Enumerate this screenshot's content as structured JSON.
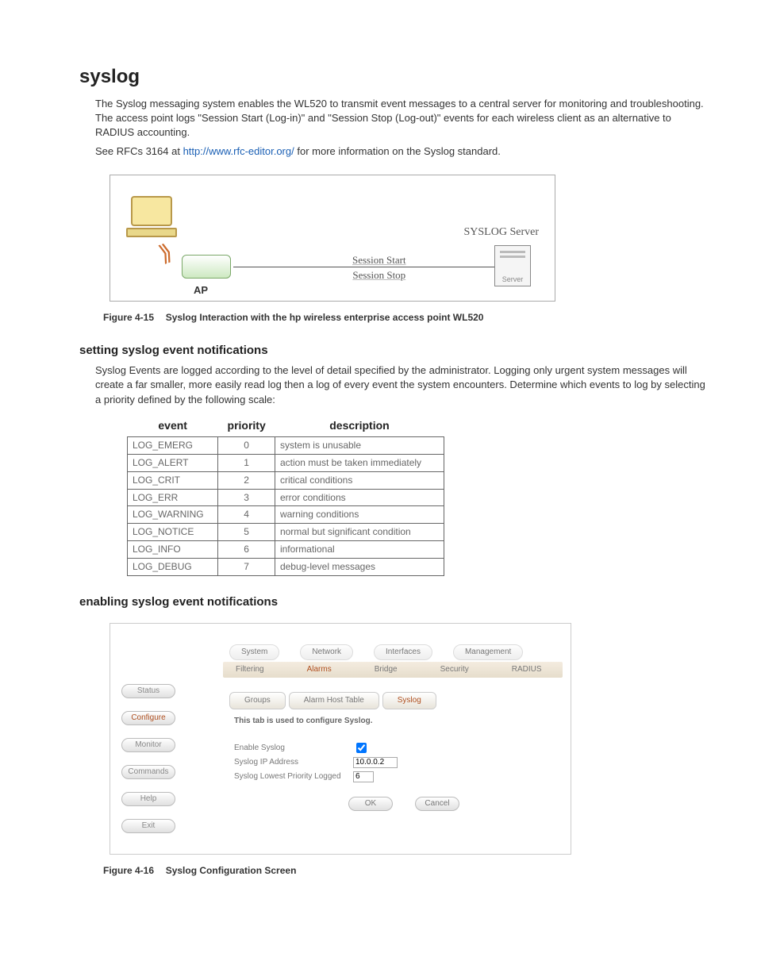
{
  "h1": "syslog",
  "intro_p1": "The Syslog messaging system enables the WL520 to transmit event messages to a central server for monitoring and troubleshooting. The access point logs \"Session Start (Log-in)\" and \"Session Stop (Log-out)\" events for each wireless client as an alternative to RADIUS accounting.",
  "intro_p2_a": "See RFCs 3164 at ",
  "intro_link": "http://www.rfc-editor.org/",
  "intro_p2_b": " for more information on the Syslog standard.",
  "diagram": {
    "ap_label": "AP",
    "session_start": "Session Start",
    "session_stop": "Session Stop",
    "server_title": "SYSLOG Server",
    "server_box": "Server"
  },
  "fig15_num": "Figure 4-15",
  "fig15_text": "Syslog Interaction with the hp wireless enterprise access point WL520",
  "h2_setting": "setting syslog event notifications",
  "setting_p": "Syslog Events are logged according to the level of detail specified by the administrator. Logging only urgent system messages will create a far smaller, more easily read log then a log of every event the system encounters. Determine which events to log by selecting a priority defined by the following scale:",
  "table": {
    "headers": {
      "event": "event",
      "priority": "priority",
      "description": "description"
    },
    "rows": [
      {
        "event": "LOG_EMERG",
        "priority": "0",
        "description": "system is unusable"
      },
      {
        "event": "LOG_ALERT",
        "priority": "1",
        "description": "action must be taken immediately"
      },
      {
        "event": "LOG_CRIT",
        "priority": "2",
        "description": "critical conditions"
      },
      {
        "event": "LOG_ERR",
        "priority": "3",
        "description": "error conditions"
      },
      {
        "event": "LOG_WARNING",
        "priority": "4",
        "description": "warning conditions"
      },
      {
        "event": "LOG_NOTICE",
        "priority": "5",
        "description": "normal but significant condition"
      },
      {
        "event": "LOG_INFO",
        "priority": "6",
        "description": "informational"
      },
      {
        "event": "LOG_DEBUG",
        "priority": "7",
        "description": "debug-level messages"
      }
    ]
  },
  "h2_enabling": "enabling syslog event notifications",
  "config": {
    "top_nav": [
      "System",
      "Network",
      "Interfaces",
      "Management"
    ],
    "sub_nav": [
      "Filtering",
      "Alarms",
      "Bridge",
      "Security",
      "RADIUS"
    ],
    "sub_nav_active": "Alarms",
    "left_nav": [
      "Status",
      "Configure",
      "Monitor",
      "Commands",
      "Help",
      "Exit"
    ],
    "left_nav_active": "Configure",
    "tabs": [
      "Groups",
      "Alarm Host Table",
      "Syslog"
    ],
    "tab_active": "Syslog",
    "tab_desc": "This tab is used to configure Syslog.",
    "fields": {
      "enable_label": "Enable Syslog",
      "enable_checked": true,
      "ip_label": "Syslog IP Address",
      "ip_value": "10.0.0.2",
      "pri_label": "Syslog Lowest Priority Logged",
      "pri_value": "6"
    },
    "buttons": {
      "ok": "OK",
      "cancel": "Cancel"
    }
  },
  "fig16_num": "Figure 4-16",
  "fig16_text": "Syslog Configuration Screen"
}
